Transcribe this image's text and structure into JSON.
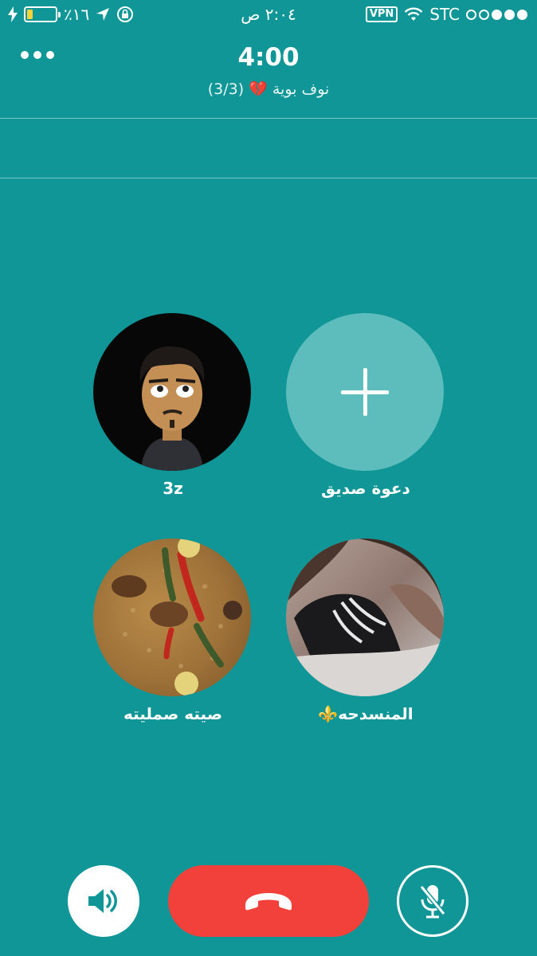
{
  "status_bar": {
    "battery_percent": "٪١٦",
    "battery_level": 0.16,
    "time": "٢:٠٤ ص",
    "vpn": "VPN",
    "carrier": "STC",
    "icons": [
      "charging-bolt-icon",
      "battery-icon",
      "location-arrow-icon",
      "rotation-lock-icon",
      "wifi-icon",
      "signal-dots-icon"
    ]
  },
  "call": {
    "timer": "4:00",
    "group_name": "نوف بوية",
    "group_emoji": "💔",
    "participant_count": "(3/3)"
  },
  "participants": [
    {
      "name": "3z",
      "avatar": "bitmoji-avatar"
    },
    {
      "name": "دعوة صديق",
      "avatar": "plus-icon"
    },
    {
      "name": "صيته صمليته",
      "avatar": "food-photo"
    },
    {
      "name": "المنسدحه⚜️",
      "avatar": "person-photo"
    }
  ],
  "controls": {
    "speaker": "speaker-icon",
    "end_call": "phone-hangup-icon",
    "mute": "mic-off-icon"
  },
  "colors": {
    "background": "#109696",
    "invite_circle": "#5dbcbc",
    "end_call": "#f2403a",
    "battery_fill": "#f3d23b",
    "heart": "#d7263d"
  }
}
